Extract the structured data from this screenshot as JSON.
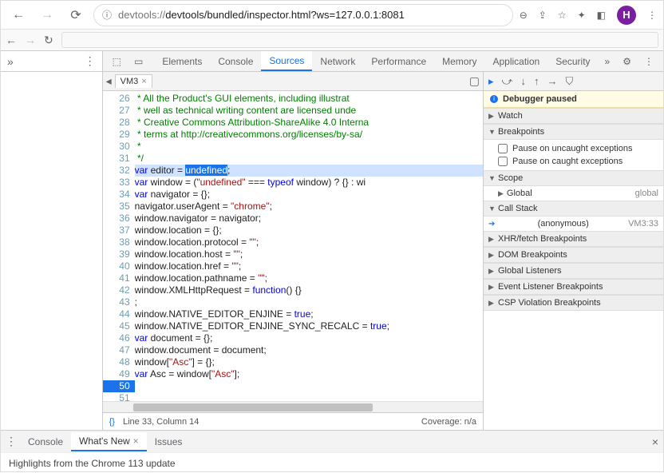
{
  "chrome": {
    "url_prefix": "devtools://",
    "url_rest": "devtools/bundled/inspector.html?ws=127.0.0.1:8081",
    "avatar_letter": "H"
  },
  "devtools_tabs": [
    "Elements",
    "Console",
    "Sources",
    "Network",
    "Performance",
    "Memory",
    "Application",
    "Security"
  ],
  "devtools_active_tab": "Sources",
  "editor": {
    "tab_label": "VM3",
    "line_col": "Line 33, Column 14",
    "coverage": "Coverage: n/a",
    "first_line_no": 26,
    "breakpoint_line": 50,
    "highlight_line": 33,
    "lines": [
      {
        "type": "c",
        "t": " * All the Product's GUI elements, including illustrat"
      },
      {
        "type": "c",
        "t": " * well as technical writing content are licensed unde"
      },
      {
        "type": "c",
        "t": " * Creative Commons Attribution-ShareAlike 4.0 Interna"
      },
      {
        "type": "c",
        "t": " * terms at http://creativecommons.org/licenses/by-sa/"
      },
      {
        "type": "c",
        "t": " *"
      },
      {
        "type": "c",
        "t": " */"
      },
      {
        "type": "n",
        "t": ""
      },
      {
        "type": "hl",
        "html": "<span class='k'>var</span> editor = <span class='sel'>undefined</span>;"
      },
      {
        "type": "n",
        "html": "<span class='k'>var</span> window = (<span class='s'>\"undefined\"</span> === <span class='k'>typeof</span> window) ? {} : wi"
      },
      {
        "type": "n",
        "html": "<span class='k'>var</span> navigator = {};"
      },
      {
        "type": "n",
        "html": "navigator.userAgent = <span class='s'>\"chrome\"</span>;"
      },
      {
        "type": "n",
        "html": "window.navigator = navigator;"
      },
      {
        "type": "n",
        "html": "window.location = {};"
      },
      {
        "type": "n",
        "t": ""
      },
      {
        "type": "n",
        "html": "window.location.protocol = <span class='s'>\"\"</span>;"
      },
      {
        "type": "n",
        "html": "window.location.host = <span class='s'>\"\"</span>;"
      },
      {
        "type": "n",
        "html": "window.location.href = <span class='s'>\"\"</span>;"
      },
      {
        "type": "n",
        "html": "window.location.pathname = <span class='s'>\"\"</span>;"
      },
      {
        "type": "n",
        "t": ""
      },
      {
        "type": "n",
        "html": "window.XMLHttpRequest = <span class='k'>function</span>() {}"
      },
      {
        "type": "n",
        "t": ";"
      },
      {
        "type": "n",
        "t": ""
      },
      {
        "type": "n",
        "html": "window.NATIVE_EDITOR_ENJINE = <span class='k'>true</span>;"
      },
      {
        "type": "n",
        "html": "window.NATIVE_EDITOR_ENJINE_SYNC_RECALC = <span class='k'>true</span>;"
      },
      {
        "type": "n",
        "t": ""
      },
      {
        "type": "n",
        "html": "<span class='k'>var</span> document = {};"
      },
      {
        "type": "n",
        "html": "window.document = document;"
      },
      {
        "type": "n",
        "t": ""
      },
      {
        "type": "n",
        "html": "window[<span class='s'>\"Asc\"</span>] = {};"
      },
      {
        "type": "n",
        "html": "<span class='k'>var</span> Asc = window[<span class='s'>\"Asc\"</span>];"
      }
    ]
  },
  "debugger": {
    "paused_text": "Debugger paused",
    "sections": {
      "watch": "Watch",
      "breakpoints": "Breakpoints",
      "bp_uncaught": "Pause on uncaught exceptions",
      "bp_caught": "Pause on caught exceptions",
      "scope": "Scope",
      "scope_global_label": "Global",
      "scope_global_value": "global",
      "callstack": "Call Stack",
      "stack_frame": "(anonymous)",
      "stack_loc": "VM3:33",
      "xhr": "XHR/fetch Breakpoints",
      "dom": "DOM Breakpoints",
      "listeners": "Global Listeners",
      "event": "Event Listener Breakpoints",
      "csp": "CSP Violation Breakpoints"
    }
  },
  "drawer": {
    "tabs": [
      "Console",
      "What's New",
      "Issues"
    ],
    "active": "What's New",
    "body": "Highlights from the Chrome 113 update"
  }
}
